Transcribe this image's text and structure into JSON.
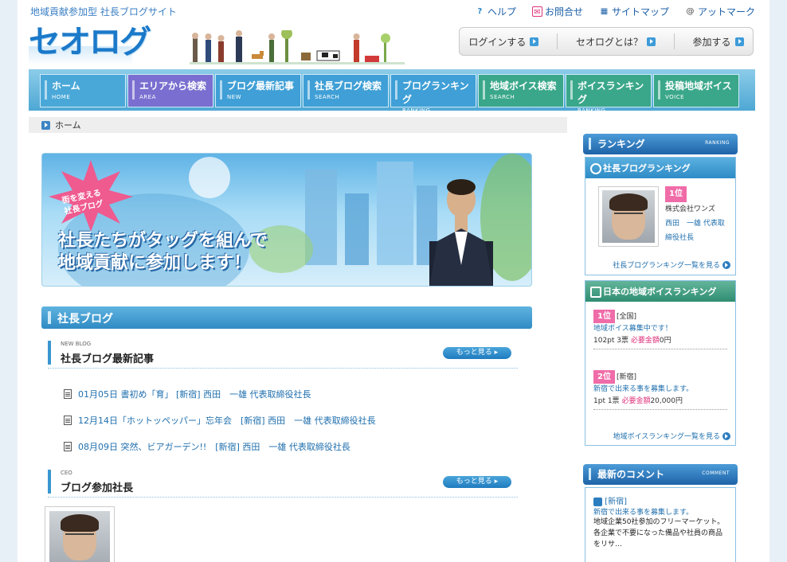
{
  "header": {
    "tagline": "地域貢献参加型 社長ブログサイト",
    "logo": "セオログ",
    "util_links": [
      {
        "label": "ヘルプ",
        "icon": "help-icon",
        "color": "#2a86c8"
      },
      {
        "label": "お問合せ",
        "icon": "mail-icon",
        "color": "#e0307a"
      },
      {
        "label": "サイトマップ",
        "icon": "sitemap-icon",
        "color": "#1b5fa8"
      },
      {
        "label": "アットマーク",
        "icon": "at-mark-icon",
        "color": "#444444"
      }
    ],
    "top_buttons": [
      "ログインする",
      "セオログとは？",
      "参加する"
    ]
  },
  "nav": [
    {
      "label": "ホーム",
      "sub": "HOME",
      "color": "#4aa8d8"
    },
    {
      "label": "エリアから検索",
      "sub": "AREA",
      "color": "#7a6fd0"
    },
    {
      "label": "ブログ最新記事",
      "sub": "NEW",
      "color": "#3f9fd6"
    },
    {
      "label": "社長ブログ検索",
      "sub": "SEARCH",
      "color": "#3f9fd6"
    },
    {
      "label": "ブログランキング",
      "sub": "RANKING",
      "color": "#3f9fd6"
    },
    {
      "label": "地域ボイス検索",
      "sub": "SEARCH",
      "color": "#3aa78a"
    },
    {
      "label": "ボイスランキング",
      "sub": "RANKING",
      "color": "#3aa78a"
    },
    {
      "label": "投稿地域ボイス",
      "sub": "VOICE",
      "color": "#3aa78a"
    }
  ],
  "breadcrumb": {
    "label": "ホーム"
  },
  "banner": {
    "badge_line1": "街を変える",
    "badge_line2": "社長ブログ",
    "line1": "社長たちがタッグを組んで",
    "line2": "地域貢献に参加します！"
  },
  "main": {
    "section_title": "社長ブログ",
    "latest": {
      "en": "NEW BLOG",
      "title": "社長ブログ最新記事",
      "more": "もっと見る ▸",
      "items": [
        "01月05日  書初め「育」 [新宿] 西田　一雄 代表取締役社長",
        "12月14日「ホットッペッパー」忘年会　[新宿] 西田　一雄 代表取締役社長",
        "08月09日  突然、ビアガーデン!!　[新宿] 西田　一雄 代表取締役社長"
      ]
    },
    "ceo": {
      "en": "CEO",
      "title": "ブログ参加社長",
      "more": "もっと見る ▸"
    }
  },
  "sidebar": {
    "ranking_head": "ランキング",
    "ranking_head_en": "RANKING",
    "blog_ranking": {
      "title": "社長ブログランキング",
      "rank": "1位",
      "company": "株式会社ワンズ",
      "person_line1": "西田　一雄 代表取",
      "person_line2": "締役社長",
      "link": "社長ブログランキング一覧を見る"
    },
    "voice_ranking": {
      "title": "日本の地域ボイスランキング",
      "entries": [
        {
          "rank": "1位",
          "area": "[全国]",
          "title": "地域ボイス募集中です！",
          "pt": "102pt 3票",
          "need_label": "必要金額",
          "amount": "0円"
        },
        {
          "rank": "2位",
          "area": "[新宿]",
          "title": "新宿で出来る事を募集します。",
          "pt": "1pt 1票",
          "need_label": "必要金額",
          "amount": "20,000円"
        }
      ],
      "link": "地域ボイスランキング一覧を見る"
    },
    "comment_head": "最新のコメント",
    "comment_head_en": "COMMENT",
    "comment": {
      "region": "[新宿]",
      "title": "新宿で出来る事を募集します。",
      "body": "地域企業50社参加のフリーマーケット。各企業で不要になった備品や社員の商品をリサ…"
    }
  }
}
